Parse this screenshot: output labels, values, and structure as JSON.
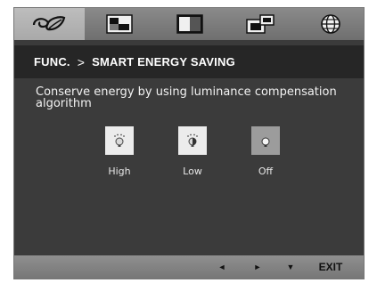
{
  "tabs": [
    {
      "name": "eco-tab",
      "icon": "eco-leaf-icon",
      "active": true
    },
    {
      "name": "picture-tab",
      "icon": "picture-icon",
      "active": false
    },
    {
      "name": "color-tab",
      "icon": "color-icon",
      "active": false
    },
    {
      "name": "screen-tab",
      "icon": "screen-position-icon",
      "active": false
    },
    {
      "name": "language-tab",
      "icon": "globe-icon",
      "active": false
    }
  ],
  "header": {
    "section": "FUNC.",
    "separator": ">",
    "title": "SMART ENERGY SAVING"
  },
  "description": "Conserve energy by using luminance compensation algorithm",
  "options": [
    {
      "label": "High",
      "icon": "bulb-high-icon",
      "selected": false
    },
    {
      "label": "Low",
      "icon": "bulb-low-icon",
      "selected": false
    },
    {
      "label": "Off",
      "icon": "bulb-off-icon",
      "selected": true
    }
  ],
  "footer": {
    "left_symbol": "◄",
    "right_symbol": "►",
    "down_symbol": "▼",
    "exit_label": "EXIT"
  },
  "colors": {
    "panel_bg": "#3b3b3b",
    "header_bg": "#262626",
    "bar_gray": "#8a8a8a",
    "option_bg": "#ececec",
    "option_selected_bg": "#9c9c9c"
  }
}
